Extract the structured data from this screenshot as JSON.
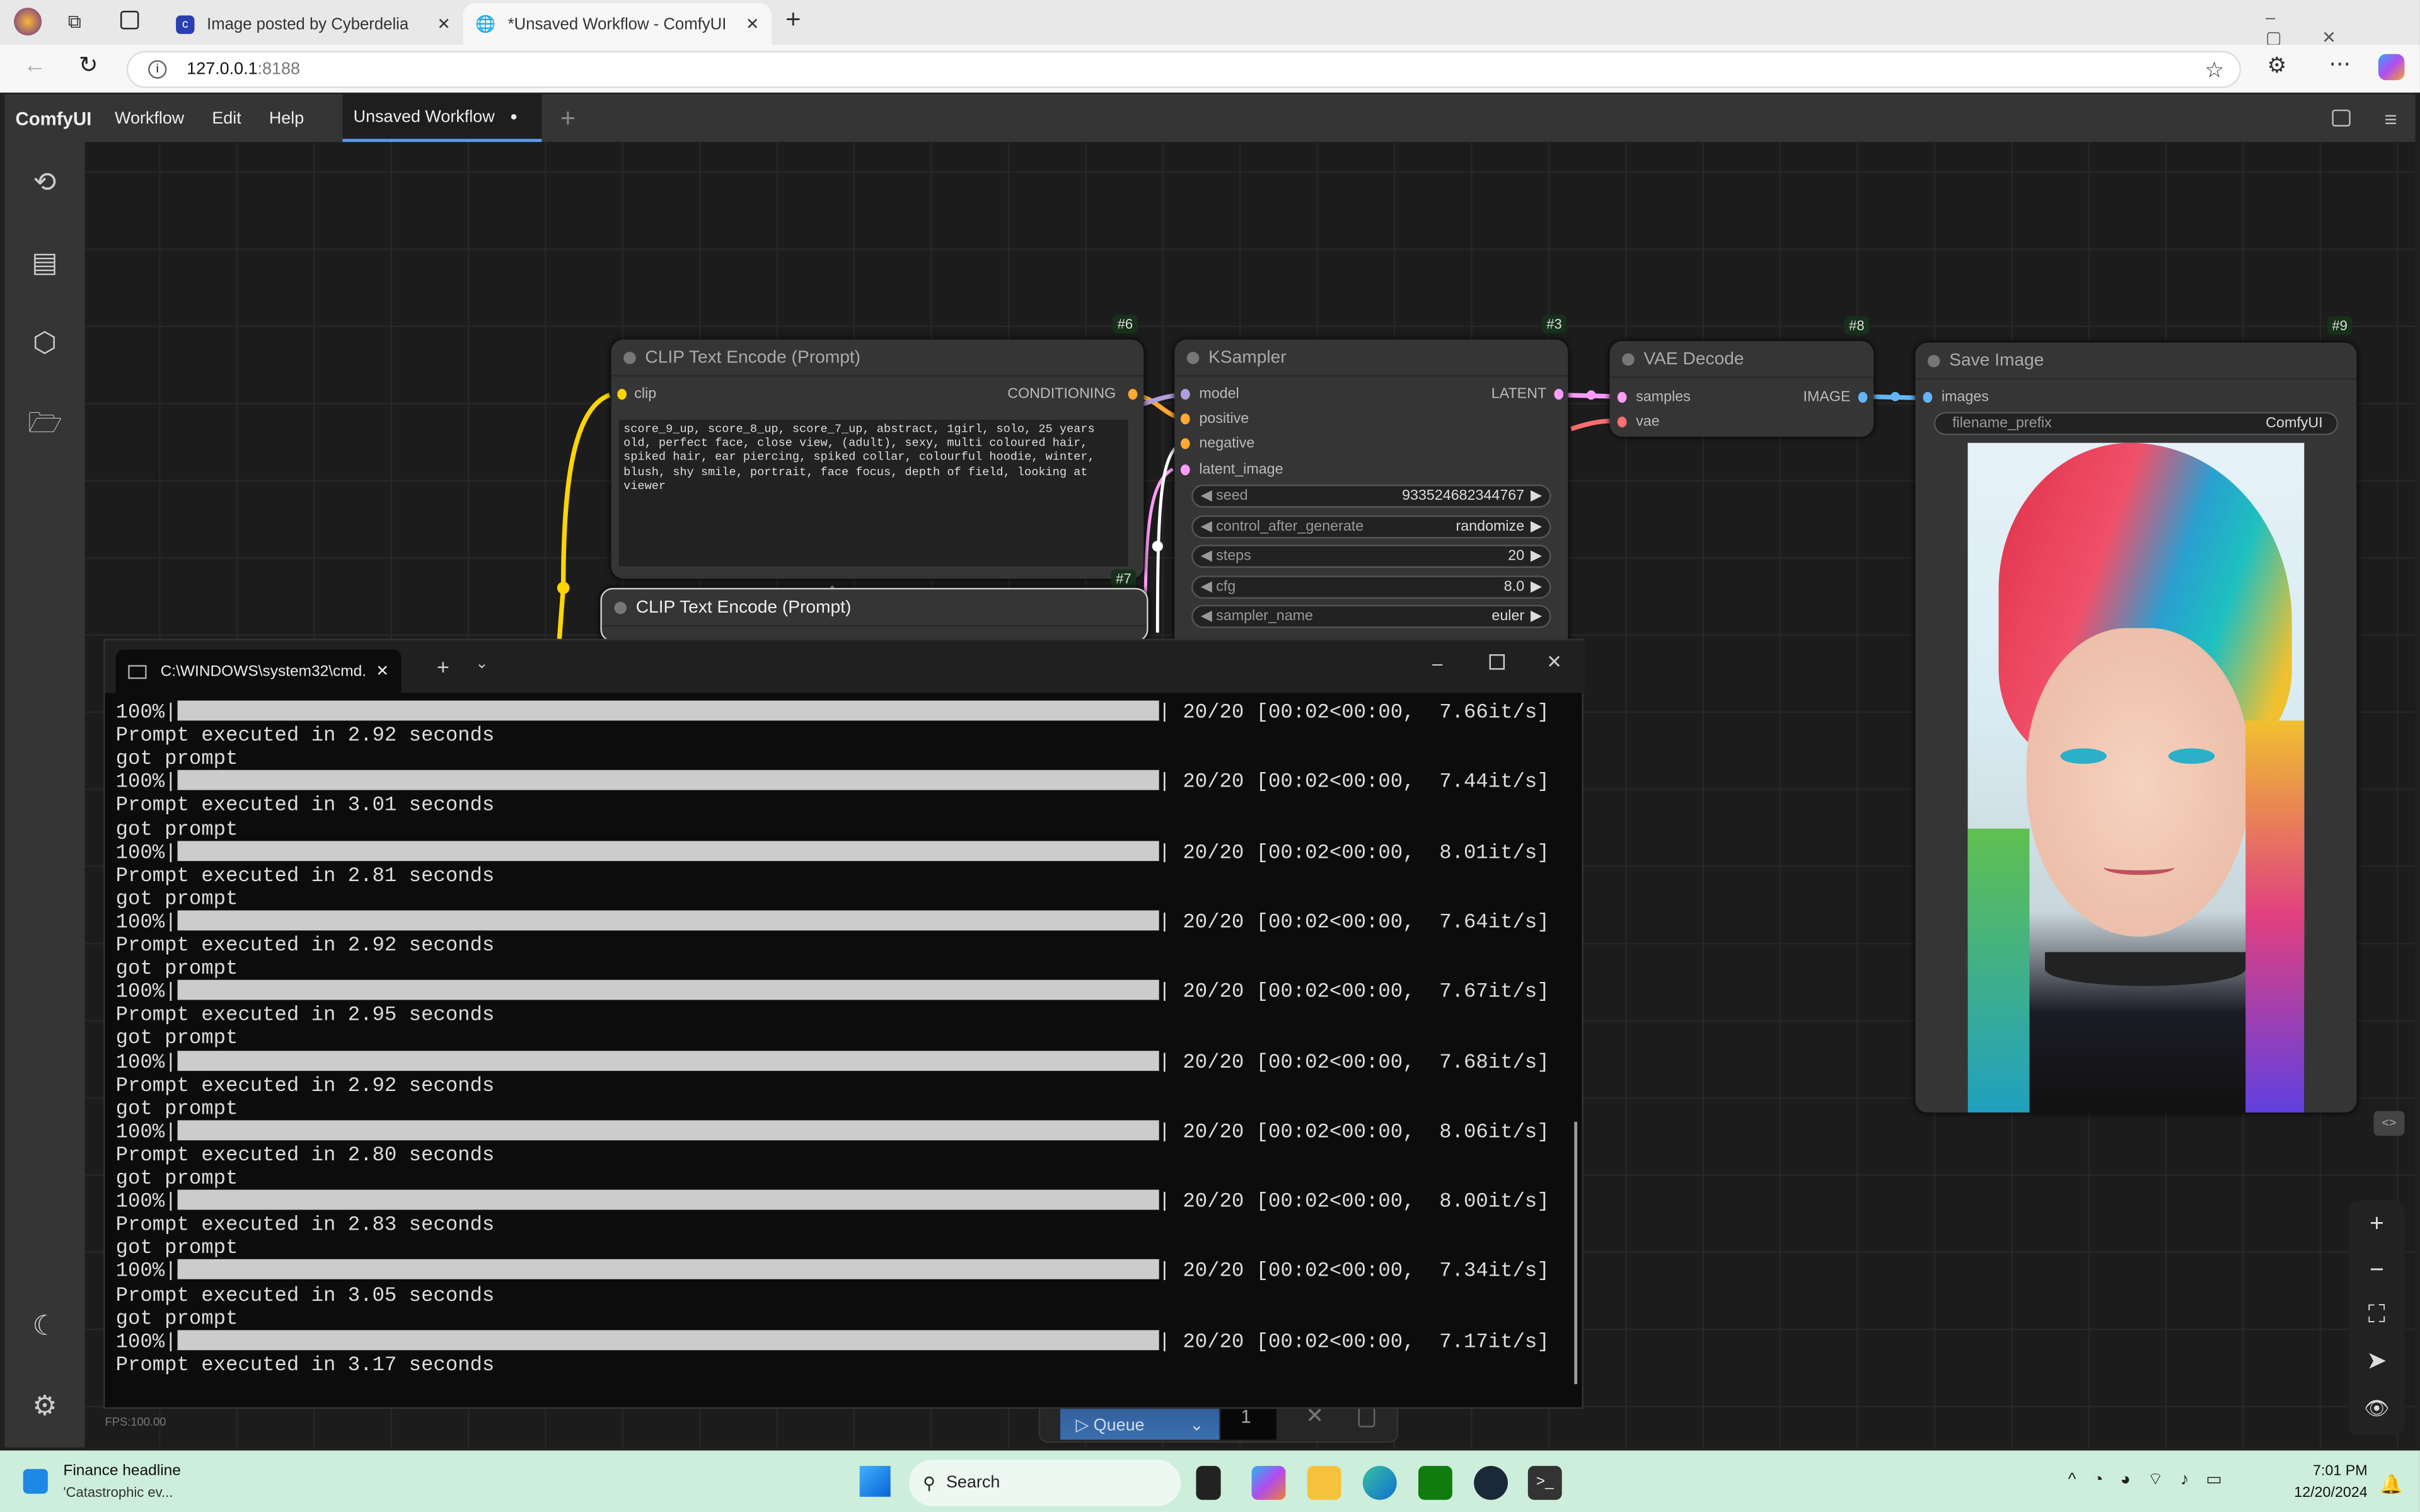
{
  "browser": {
    "tabs": [
      {
        "label": "Image posted by Cyberdelia",
        "icon": "cyberdelia-c-icon"
      },
      {
        "label": "*Unsaved Workflow - ComfyUI",
        "icon": "globe-icon"
      }
    ],
    "url_host": "127.0.0.1",
    "url_port": ":8188"
  },
  "menu": {
    "brand": "ComfyUI",
    "items": [
      "Workflow",
      "Edit",
      "Help"
    ],
    "workflow_tab": "Unsaved Workflow",
    "unsaved_marker": "●"
  },
  "nodes": {
    "clip1": {
      "title": "CLIP Text Encode (Prompt)",
      "id": "#6",
      "input": "clip",
      "output": "CONDITIONING",
      "text": "score_9_up, score_8_up, score_7_up, abstract, 1girl, solo, 25 years old, perfect face, close view, (adult), sexy, multi coloured hair, spiked hair, ear piercing, spiked collar, colourful hoodie, winter, blush, shy smile, portrait, face focus, depth of field, looking at viewer"
    },
    "clip2": {
      "title": "CLIP Text Encode (Prompt)",
      "id": "#7"
    },
    "ksampler": {
      "title": "KSampler",
      "id": "#3",
      "inputs": [
        "model",
        "positive",
        "negative",
        "latent_image"
      ],
      "output": "LATENT",
      "widgets": [
        {
          "label": "seed",
          "value": "933524682344767"
        },
        {
          "label": "control_after_generate",
          "value": "randomize"
        },
        {
          "label": "steps",
          "value": "20"
        },
        {
          "label": "cfg",
          "value": "8.0"
        },
        {
          "label": "sampler_name",
          "value": "euler"
        }
      ]
    },
    "vae": {
      "title": "VAE Decode",
      "id": "#8",
      "inputs": [
        "samples",
        "vae"
      ],
      "output": "IMAGE"
    },
    "save": {
      "title": "Save Image",
      "id": "#9",
      "input": "images",
      "widget_label": "filename_prefix",
      "widget_value": "ComfyUI"
    }
  },
  "slot_colors": {
    "clip": "#ffd500",
    "conditioning": "#ffa931",
    "model": "#b39ddb",
    "latent": "#ff9cf9",
    "image": "#64b5f6",
    "vae": "#ff6e6e"
  },
  "terminal": {
    "title": "C:\\WINDOWS\\system32\\cmd.",
    "runs": [
      {
        "rate": "7.66it/s",
        "time": "2.92"
      },
      {
        "rate": "7.44it/s",
        "time": "3.01"
      },
      {
        "rate": "8.01it/s",
        "time": "2.81"
      },
      {
        "rate": "7.64it/s",
        "time": "2.92"
      },
      {
        "rate": "7.67it/s",
        "time": "2.95"
      },
      {
        "rate": "7.68it/s",
        "time": "2.92"
      },
      {
        "rate": "8.06it/s",
        "time": "2.80"
      },
      {
        "rate": "8.00it/s",
        "time": "2.83"
      },
      {
        "rate": "7.34it/s",
        "time": "3.05"
      },
      {
        "rate": "7.17it/s",
        "time": "3.17"
      }
    ],
    "percent": "100%|",
    "steps": "| 20/20 [00:02<00:00,  ",
    "executed_prefix": "Prompt executed in ",
    "executed_suffix": " seconds",
    "got_prompt": "got prompt"
  },
  "queue": {
    "label": "Queue",
    "count": "1"
  },
  "fps": "FPS:100.00",
  "taskbar": {
    "news_title": "Finance headline",
    "news_sub": "'Catastrophic ev...",
    "search": "Search",
    "time": "7:01 PM",
    "date": "12/20/2024"
  }
}
